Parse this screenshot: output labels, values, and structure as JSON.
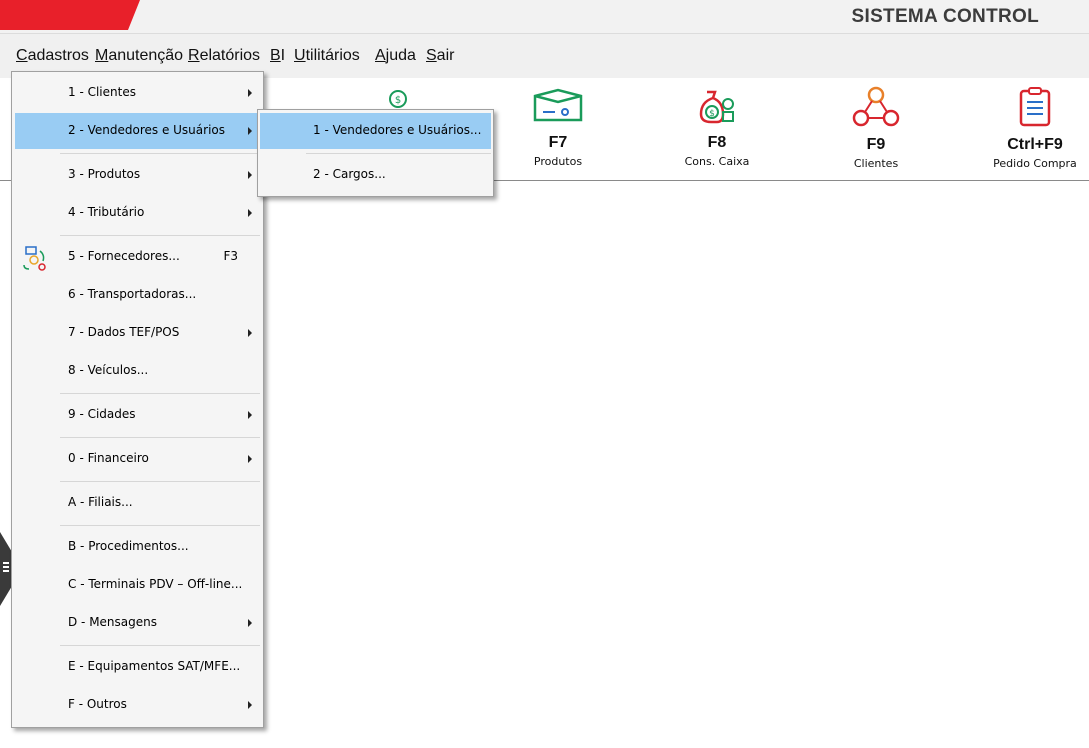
{
  "app": {
    "title": "SISTEMA CONTROL"
  },
  "menubar": {
    "items": [
      {
        "accel": "C",
        "rest": "adastros"
      },
      {
        "accel": "M",
        "rest": "anutenção"
      },
      {
        "accel": "R",
        "rest": "elatórios"
      },
      {
        "accel": "B",
        "rest": "I"
      },
      {
        "accel": "U",
        "rest": "tilitários"
      },
      {
        "accel": "A",
        "rest": "juda"
      },
      {
        "accel": "S",
        "rest": "air"
      }
    ]
  },
  "toolbar": {
    "items": [
      {
        "key": "F7",
        "label": "Produtos",
        "icon": "box-icon"
      },
      {
        "key": "F8",
        "label": "Cons. Caixa",
        "icon": "money-bag-icon"
      },
      {
        "key": "F9",
        "label": "Clientes",
        "icon": "people-network-icon"
      },
      {
        "key": "Ctrl+F9",
        "label": "Pedido Compra",
        "icon": "clipboard-icon"
      }
    ]
  },
  "cadastros_menu": {
    "items": [
      {
        "label": "1 - Clientes",
        "submenu": true
      },
      {
        "label": "2 - Vendedores e Usuários",
        "submenu": true,
        "highlighted": true
      },
      {
        "label": "3 - Produtos",
        "submenu": true
      },
      {
        "label": "4 - Tributário",
        "submenu": true
      },
      {
        "label": "5 - Fornecedores...",
        "shortcut": "F3",
        "icon": "supplier-icon"
      },
      {
        "label": "6 - Transportadoras..."
      },
      {
        "label": "7 - Dados TEF/POS",
        "submenu": true
      },
      {
        "label": "8 - Veículos..."
      },
      {
        "label": "9 - Cidades",
        "submenu": true
      },
      {
        "label": "0 - Financeiro",
        "submenu": true
      },
      {
        "label": "A - Filiais..."
      },
      {
        "label": "B - Procedimentos..."
      },
      {
        "label": "C -  Terminais PDV – Off-line..."
      },
      {
        "label": "D - Mensagens",
        "submenu": true
      },
      {
        "label": "E - Equipamentos SAT/MFE..."
      },
      {
        "label": "F - Outros",
        "submenu": true
      }
    ]
  },
  "vendedores_submenu": {
    "items": [
      {
        "label": "1 - Vendedores e Usuários...",
        "highlighted": true
      },
      {
        "label": "2 - Cargos..."
      }
    ]
  }
}
